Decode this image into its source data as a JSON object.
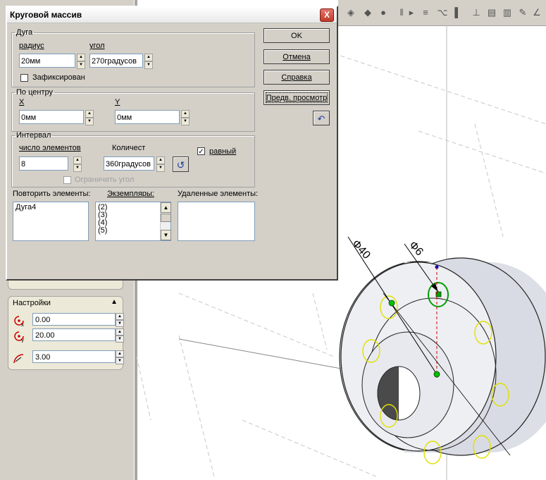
{
  "dialog": {
    "title": "Круговой массив",
    "close": "X",
    "arc": {
      "group": "Дуга",
      "radius_label": "радиус",
      "radius_value": "20мм",
      "angle_label": "угол",
      "angle_value": "270градусов",
      "fixed_label": "Зафиксирован"
    },
    "center": {
      "group": "По центру",
      "x_label": "X",
      "x_value": "0мм",
      "y_label": "Y",
      "y_value": "0мм"
    },
    "interval": {
      "group": "Интервал",
      "count_label": "число элементов",
      "count_value": "8",
      "amount_label": "Количест",
      "amount_value": "360градусов",
      "equal_label": "равный",
      "limit_label": "Ограничить угол"
    },
    "lists": {
      "repeat_label": "Повторить элементы:",
      "repeat_items": [
        "Дуга4"
      ],
      "instances_label": "Экземпляры:",
      "instances_items": [
        "(2)",
        "(3)",
        "(4)",
        "(5)"
      ],
      "deleted_label": "Удаленные элементы:"
    },
    "buttons": {
      "ok": "OK",
      "cancel": "Отмена",
      "help": "Справка",
      "preview": "Предв. просмотр"
    }
  },
  "settings": {
    "title": "Настройки",
    "x_value": "0.00",
    "y_value": "20.00",
    "r_value": "3.00"
  },
  "drawing": {
    "dim_large": "Ф40",
    "dim_small": "Ф6"
  }
}
